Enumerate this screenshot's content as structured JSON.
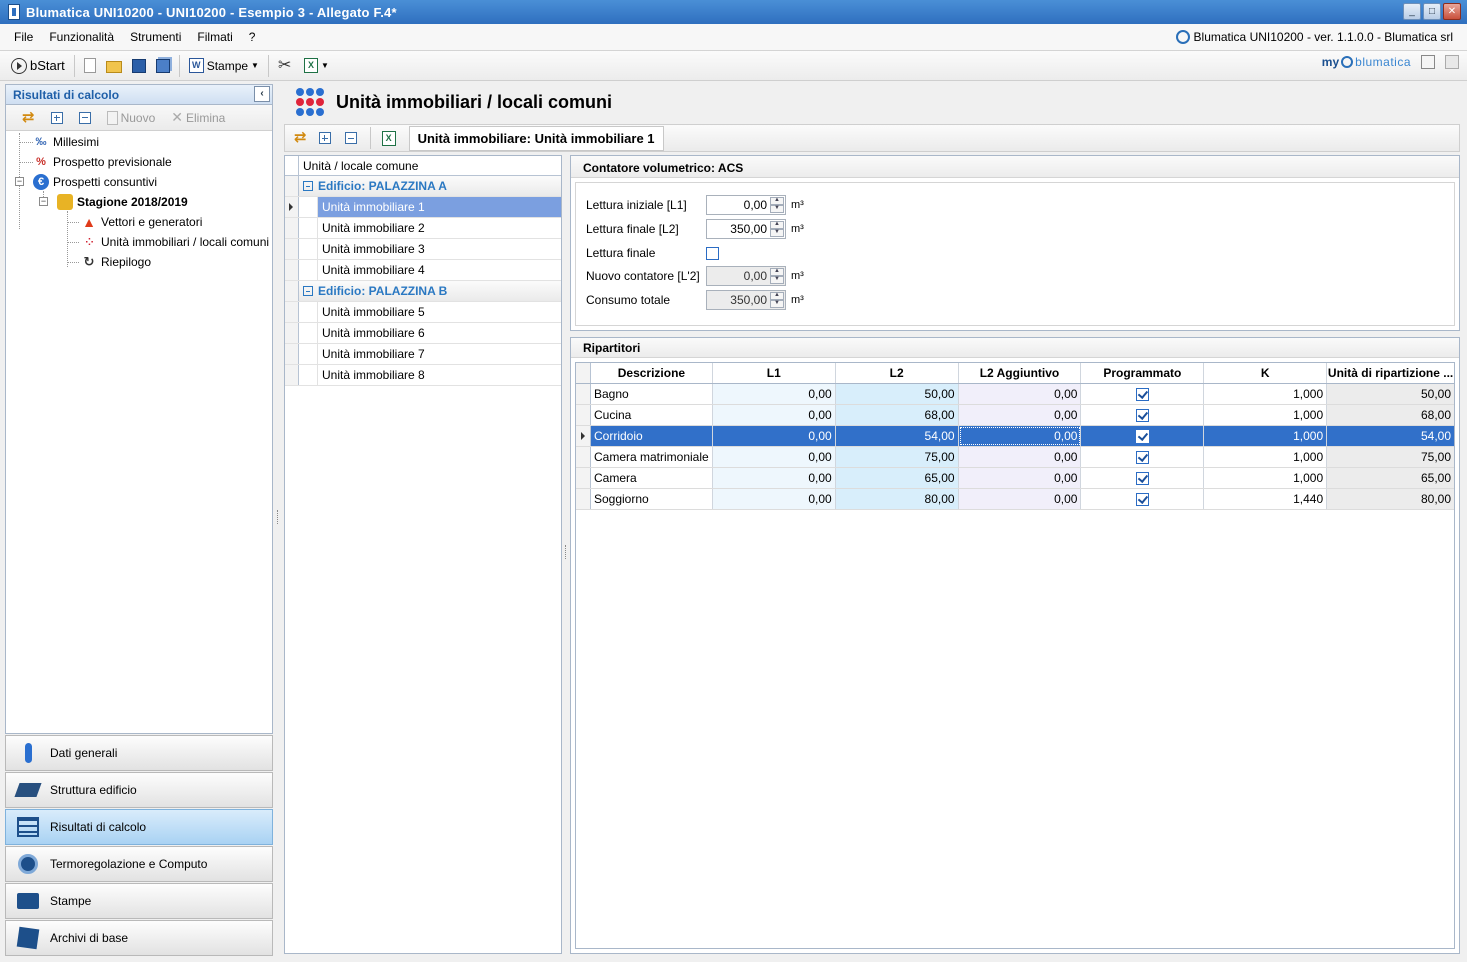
{
  "window": {
    "title": "Blumatica UNI10200 - UNI10200 - Esempio 3 - Allegato F.4*"
  },
  "menu": {
    "items": [
      "File",
      "Funzionalità",
      "Strumenti",
      "Filmati",
      "?"
    ],
    "brand": "Blumatica UNI10200 - ver. 1.1.0.0 - Blumatica srl"
  },
  "toolbar": {
    "bstart": "bStart",
    "stampe": "Stampe",
    "my": "my",
    "blumatica": "blumatica"
  },
  "left_panel": {
    "title": "Risultati di calcolo",
    "nuovo": "Nuovo",
    "elimina": "Elimina",
    "tree": {
      "millesimi": "Millesimi",
      "prospetto_previsionale": "Prospetto previsionale",
      "prospetti_consuntivi": "Prospetti consuntivi",
      "stagione": "Stagione 2018/2019",
      "vettori": "Vettori e generatori",
      "unita": "Unità immobiliari / locali comuni",
      "riepilogo": "Riepilogo"
    }
  },
  "nav": {
    "dati_generali": "Dati generali",
    "struttura_edificio": "Struttura edificio",
    "risultati_calcolo": "Risultati di calcolo",
    "termoregolazione": "Termoregolazione e Computo",
    "stampe": "Stampe",
    "archivi": "Archivi di base"
  },
  "main": {
    "title": "Unità immobiliari / locali comuni",
    "unit_label": "Unità immobiliare:  Unità immobiliare 1"
  },
  "list": {
    "header": "Unità / locale comune",
    "groups": [
      {
        "label": "Edificio: PALAZZINA A",
        "items": [
          "Unità immobiliare 1",
          "Unità immobiliare 2",
          "Unità immobiliare 3",
          "Unità immobiliare 4"
        ]
      },
      {
        "label": "Edificio: PALAZZINA B",
        "items": [
          "Unità immobiliare 5",
          "Unità immobiliare 6",
          "Unità immobiliare 7",
          "Unità immobiliare 8"
        ]
      }
    ]
  },
  "contatore": {
    "title": "Contatore volumetrico: ACS",
    "lettura_iniziale": {
      "label": "Lettura iniziale [L1]",
      "value": "0,00",
      "unit": "m³"
    },
    "lettura_finale": {
      "label": "Lettura finale [L2]",
      "value": "350,00",
      "unit": "m³"
    },
    "lettura_finale_chk": {
      "label": "Lettura finale"
    },
    "nuovo_contatore": {
      "label": "Nuovo contatore [L'2]",
      "value": "0,00",
      "unit": "m³"
    },
    "consumo_totale": {
      "label": "Consumo totale",
      "value": "350,00",
      "unit": "m³"
    }
  },
  "ripartitori": {
    "title": "Ripartitori",
    "columns": [
      "Descrizione",
      "L1",
      "L2",
      "L2 Aggiuntivo",
      "Programmato",
      "K",
      "Unità di ripartizione ..."
    ],
    "rows": [
      {
        "descrizione": "Bagno",
        "l1": "0,00",
        "l2": "50,00",
        "l2a": "0,00",
        "programmato": true,
        "k": "1,000",
        "ur": "50,00"
      },
      {
        "descrizione": "Cucina",
        "l1": "0,00",
        "l2": "68,00",
        "l2a": "0,00",
        "programmato": true,
        "k": "1,000",
        "ur": "68,00"
      },
      {
        "descrizione": "Corridoio",
        "l1": "0,00",
        "l2": "54,00",
        "l2a": "0,00",
        "programmato": true,
        "k": "1,000",
        "ur": "54,00"
      },
      {
        "descrizione": "Camera matrimoniale",
        "l1": "0,00",
        "l2": "75,00",
        "l2a": "0,00",
        "programmato": true,
        "k": "1,000",
        "ur": "75,00"
      },
      {
        "descrizione": "Camera",
        "l1": "0,00",
        "l2": "65,00",
        "l2a": "0,00",
        "programmato": true,
        "k": "1,000",
        "ur": "65,00"
      },
      {
        "descrizione": "Soggiorno",
        "l1": "0,00",
        "l2": "80,00",
        "l2a": "0,00",
        "programmato": true,
        "k": "1,440",
        "ur": "80,00"
      }
    ]
  }
}
